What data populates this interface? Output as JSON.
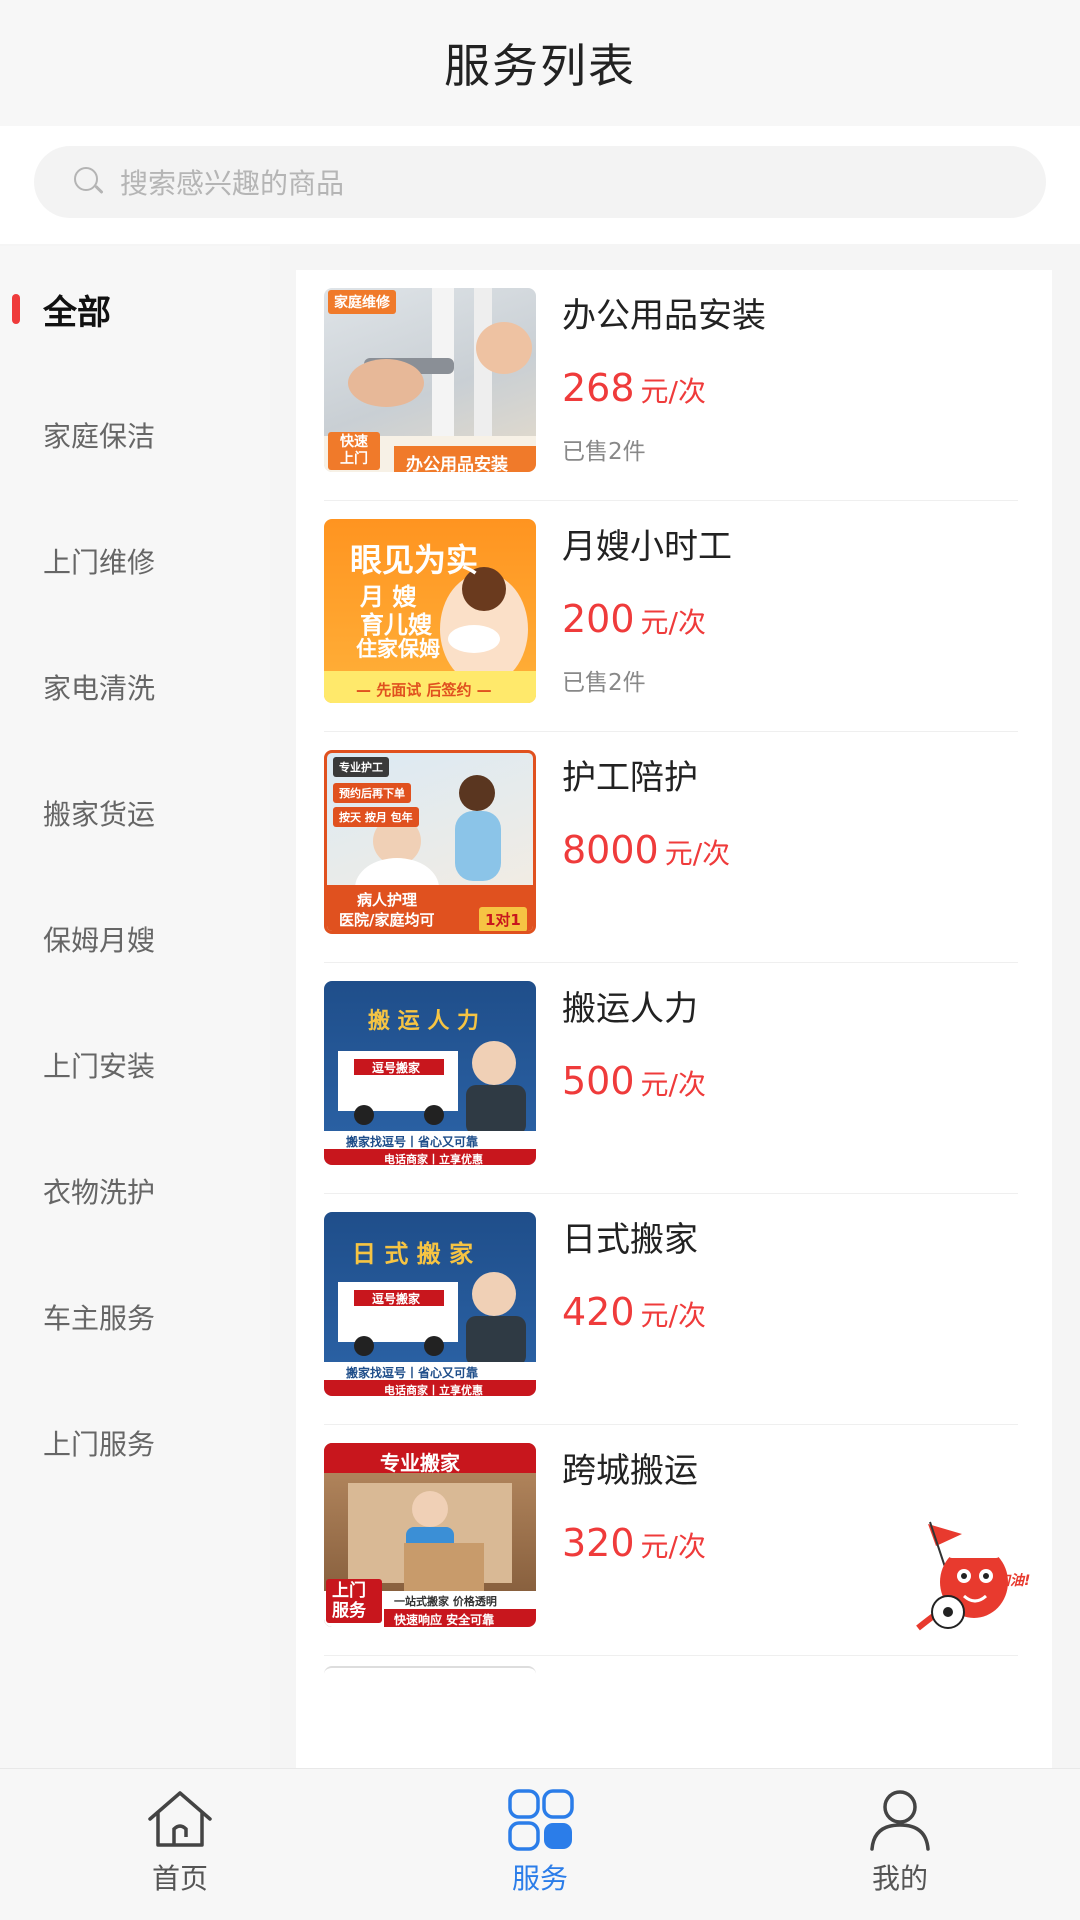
{
  "header": {
    "title": "服务列表"
  },
  "search": {
    "placeholder": "搜索感兴趣的商品"
  },
  "sidebar": {
    "items": [
      {
        "label": "全部",
        "active": true
      },
      {
        "label": "家庭保洁"
      },
      {
        "label": "上门维修"
      },
      {
        "label": "家电清洗"
      },
      {
        "label": "搬家货运"
      },
      {
        "label": "保姆月嫂"
      },
      {
        "label": "上门安装"
      },
      {
        "label": "衣物洗护"
      },
      {
        "label": "车主服务"
      },
      {
        "label": "上门服务"
      }
    ]
  },
  "products": [
    {
      "name": "办公用品安装",
      "price": "268",
      "unit": "元/次",
      "sold": "已售2件",
      "thumb": {
        "top_tag": "家庭维修",
        "corner": "快速上门",
        "caption": "办公用品安装",
        "colors": [
          "#cfd6dc",
          "#e8e2d6"
        ],
        "accent": "#f07a2a"
      }
    },
    {
      "name": "月嫂小时工",
      "price": "200",
      "unit": "元/次",
      "sold": "已售2件",
      "thumb": {
        "line1": "眼见为实",
        "line2": "月 嫂",
        "line3": "育儿嫂",
        "line4": "住家保姆",
        "caption": "— 先面试 后签约 —",
        "colors": [
          "#ff9a1f",
          "#ffc34d"
        ],
        "accent": "#ffe34d"
      }
    },
    {
      "name": "护工陪护",
      "price": "8000",
      "unit": "元/次",
      "sold": "",
      "thumb": {
        "top_tag": "专业护工",
        "tag2": "预约后再下单",
        "tag3": "按天 按月 包年",
        "caption": "病人护理",
        "caption2": "医院/家庭均可",
        "badge": "1对1",
        "colors": [
          "#d8e9f5",
          "#f4e9dc"
        ],
        "accent": "#e0511f"
      }
    },
    {
      "name": "搬运人力",
      "price": "500",
      "unit": "元/次",
      "sold": "",
      "thumb": {
        "line1": "搬 运 人 力",
        "truck_label": "逗号搬家",
        "caption": "搬家找逗号丨省心又可靠",
        "caption2": "电话商家丨立享优惠",
        "colors": [
          "#1f4e8a",
          "#2c64a8"
        ],
        "accent": "#f6c443"
      }
    },
    {
      "name": "日式搬家",
      "price": "420",
      "unit": "元/次",
      "sold": "",
      "thumb": {
        "line1": "日 式 搬 家",
        "truck_label": "逗号搬家",
        "caption": "搬家找逗号丨省心又可靠",
        "caption2": "电话商家丨立享优惠",
        "colors": [
          "#1f4e8a",
          "#2c64a8"
        ],
        "accent": "#f6c443"
      }
    },
    {
      "name": "跨城搬运",
      "price": "320",
      "unit": "元/次",
      "sold": "",
      "thumb": {
        "line1": "专业搬家",
        "corner": "上门服务",
        "caption": "一站式搬家 价格透明",
        "caption2": "快速响应 安全可靠",
        "colors": [
          "#c7a27a",
          "#8a6442"
        ],
        "accent": "#c8161d"
      }
    }
  ],
  "mascot": {
    "label": "加油!"
  },
  "tabbar": {
    "items": [
      {
        "label": "首页",
        "icon": "home-icon"
      },
      {
        "label": "服务",
        "icon": "services-grid-icon",
        "active": true
      },
      {
        "label": "我的",
        "icon": "profile-icon"
      }
    ]
  },
  "colors": {
    "accent_red": "#ef3b3b",
    "active_blue": "#2b7de9"
  }
}
